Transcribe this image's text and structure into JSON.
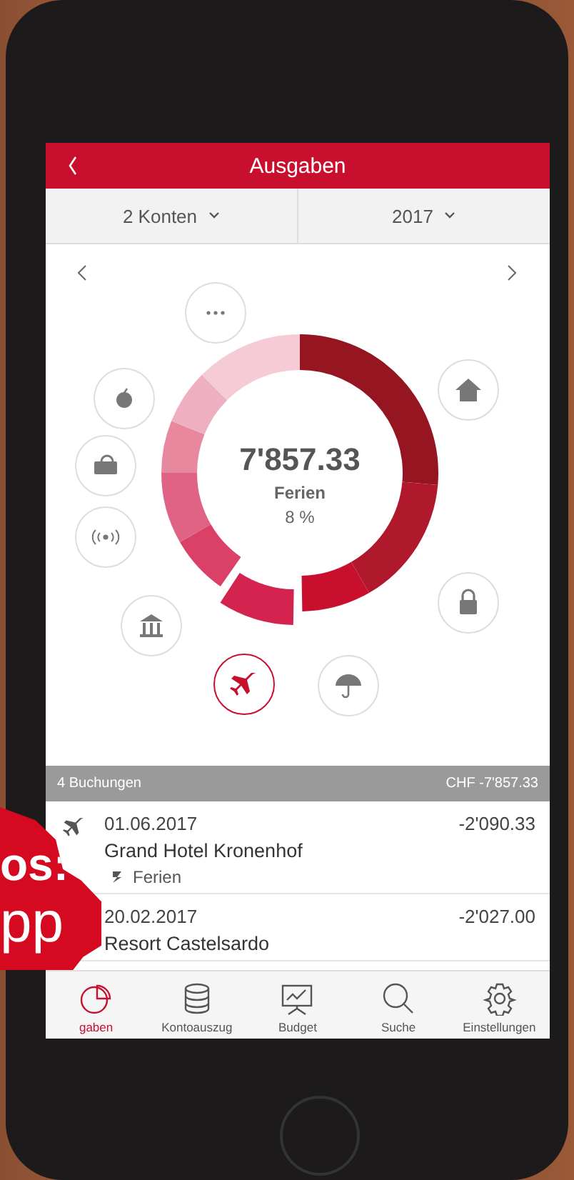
{
  "header": {
    "title": "Ausgaben"
  },
  "filters": [
    {
      "label": "2 Konten"
    },
    {
      "label": "2017"
    }
  ],
  "chart": {
    "amount": "7'857.33",
    "category": "Ferien",
    "share": "8 %"
  },
  "categories": [
    {
      "kind": "more",
      "selected": false
    },
    {
      "kind": "apple",
      "selected": false
    },
    {
      "kind": "media",
      "selected": false
    },
    {
      "kind": "signal",
      "selected": false
    },
    {
      "kind": "bank",
      "selected": false
    },
    {
      "kind": "plane",
      "selected": true
    },
    {
      "kind": "umbrella",
      "selected": false
    },
    {
      "kind": "lock",
      "selected": false
    },
    {
      "kind": "house",
      "selected": false
    }
  ],
  "summary": {
    "count": "4 Buchungen",
    "total": "CHF -7'857.33"
  },
  "bookings": [
    {
      "date": "01.06.2017",
      "amount": "-2'090.33",
      "name": "Grand Hotel Kronenhof",
      "tag": "Ferien",
      "icon": true
    },
    {
      "date": "20.02.2017",
      "amount": "-2'027.00",
      "name": "Resort Castelsardo",
      "icon": false
    }
  ],
  "tabs": [
    {
      "label": "gaben",
      "kind": "pie",
      "selected": true
    },
    {
      "label": "Kontoauszug",
      "kind": "database",
      "selected": false
    },
    {
      "label": "Budget",
      "kind": "board",
      "selected": false
    },
    {
      "label": "Suche",
      "kind": "search",
      "selected": false
    },
    {
      "label": "Einstellungen",
      "kind": "gear",
      "selected": false
    }
  ],
  "badge": {
    "lines": [
      "os:",
      "pp"
    ]
  }
}
